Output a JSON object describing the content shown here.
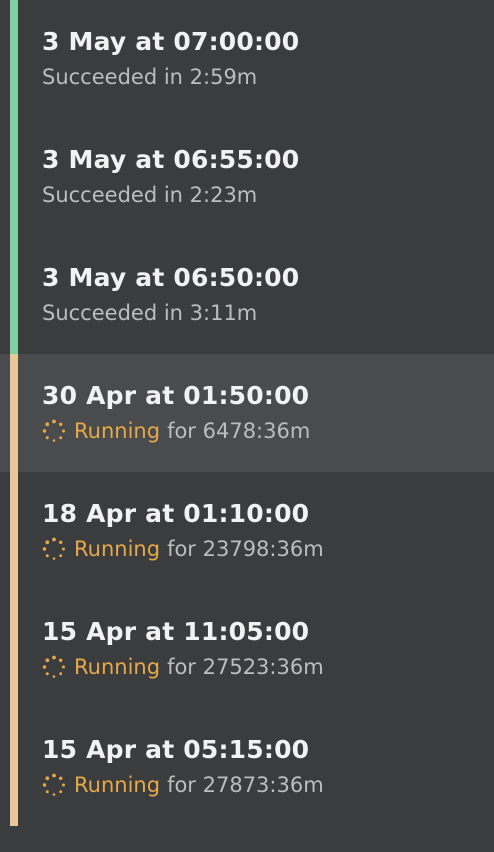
{
  "colors": {
    "background": "#3b3c3e",
    "selected_background": "#4a4b4d",
    "succeeded_bar": "#7fcfa1",
    "running_bar": "#e8c79a",
    "running_text": "#e6a94a"
  },
  "runs": [
    {
      "title": "3 May at 07:00:00",
      "status": "succeeded",
      "status_text": "Succeeded in 2:59m"
    },
    {
      "title": "3 May at 06:55:00",
      "status": "succeeded",
      "status_text": "Succeeded in 2:23m"
    },
    {
      "title": "3 May at 06:50:00",
      "status": "succeeded",
      "status_text": "Succeeded in 3:11m"
    },
    {
      "title": "30 Apr at 01:50:00",
      "status": "running",
      "icon": "spinner-icon",
      "running_label": "Running",
      "duration_text": "for 6478:36m",
      "selected": true
    },
    {
      "title": "18 Apr at 01:10:00",
      "status": "running",
      "icon": "spinner-icon",
      "running_label": "Running",
      "duration_text": "for 23798:36m"
    },
    {
      "title": "15 Apr at 11:05:00",
      "status": "running",
      "icon": "spinner-icon",
      "running_label": "Running",
      "duration_text": "for 27523:36m"
    },
    {
      "title": "15 Apr at 05:15:00",
      "status": "running",
      "icon": "spinner-icon",
      "running_label": "Running",
      "duration_text": "for 27873:36m"
    }
  ]
}
